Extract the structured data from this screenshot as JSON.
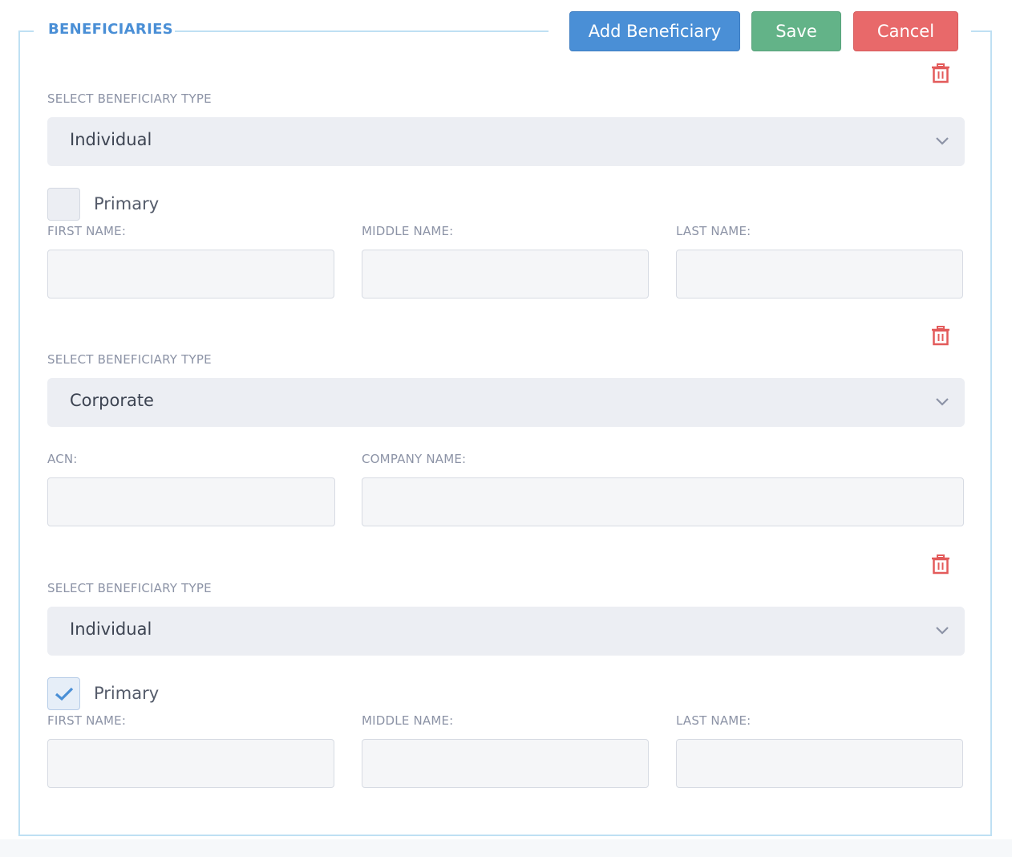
{
  "section": {
    "title": "BENEFICIARIES"
  },
  "toolbar": {
    "add_label": "Add Beneficiary",
    "save_label": "Save",
    "cancel_label": "Cancel"
  },
  "beneficiaries": [
    {
      "type_label": "SELECT BENEFICIARY TYPE",
      "type_value": "Individual",
      "primary_label": "Primary",
      "primary_checked": false,
      "first_name_label": "FIRST NAME:",
      "middle_name_label": "MIDDLE NAME:",
      "last_name_label": "LAST NAME:"
    },
    {
      "type_label": "SELECT BENEFICIARY TYPE",
      "type_value": "Corporate",
      "acn_label": "ACN:",
      "company_name_label": "COMPANY NAME:"
    },
    {
      "type_label": "SELECT BENEFICIARY TYPE",
      "type_value": "Individual",
      "primary_label": "Primary",
      "primary_checked": true,
      "first_name_label": "FIRST NAME:",
      "middle_name_label": "MIDDLE NAME:",
      "last_name_label": "LAST NAME:"
    }
  ],
  "colors": {
    "accent": "#4a8fd6",
    "save": "#63b388",
    "cancel": "#e8696a",
    "delete_icon": "#e35b5b",
    "border": "#bfe0f3"
  },
  "icons": [
    "trash-icon",
    "chevron-down-icon",
    "checkmark-icon"
  ]
}
